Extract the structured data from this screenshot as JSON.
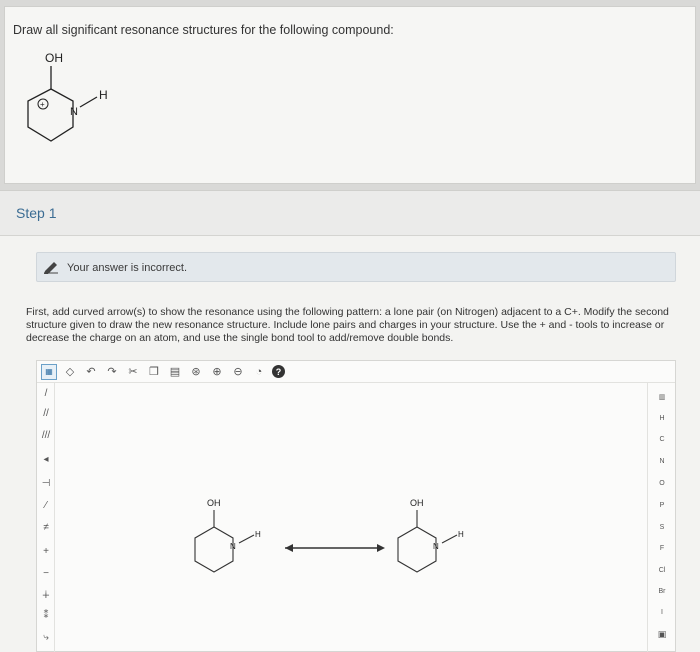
{
  "question": {
    "prompt": "Draw all significant resonance structures for the following compound:",
    "molecule": {
      "oh": "OH",
      "n": "N",
      "h": "H",
      "charge": "+"
    }
  },
  "step": {
    "label": "Step 1"
  },
  "feedback": {
    "text": "Your answer is incorrect.",
    "icon": "pencil-icon"
  },
  "instructions": "First, add curved arrow(s) to show the resonance using the following pattern: a lone pair (on Nitrogen) adjacent to a C+. Modify the second structure given to draw the new resonance structure. Include lone pairs and charges in your structure. Use the + and - tools to increase or decrease the charge on an atom, and use the single bond tool to add/remove double bonds.",
  "toolbar": {
    "items": [
      "select-icon",
      "eraser-icon",
      "undo-icon",
      "redo-icon",
      "cut-icon",
      "copy-icon",
      "paste-icon",
      "zoom-fit-icon",
      "zoom-in-icon",
      "zoom-out-icon",
      "zoom-reset-icon",
      "help-icon"
    ],
    "help_label": "?"
  },
  "elements": [
    "H",
    "C",
    "N",
    "O",
    "P",
    "S",
    "F",
    "Cl",
    "Br",
    "I"
  ],
  "canvas": {
    "structure1": {
      "oh": "OH",
      "n": "N",
      "h": "H"
    },
    "structure2": {
      "oh": "OH",
      "n": "N",
      "h": "H"
    },
    "arrow": "resonance-arrow"
  }
}
